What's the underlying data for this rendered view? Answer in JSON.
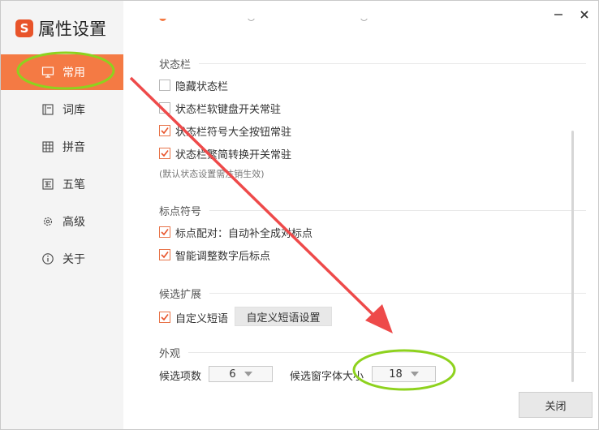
{
  "app": {
    "title": "属性设置",
    "logo_letter": "S"
  },
  "sidebar": {
    "items": [
      {
        "label": "常用",
        "icon": "monitor-icon",
        "active": true
      },
      {
        "label": "词库",
        "icon": "dictionary-icon",
        "active": false
      },
      {
        "label": "拼音",
        "icon": "pinyin-grid-icon",
        "active": false
      },
      {
        "label": "五笔",
        "icon": "wubi-icon",
        "active": false
      },
      {
        "label": "高级",
        "icon": "gear-icon",
        "active": false
      },
      {
        "label": "关于",
        "icon": "info-icon",
        "active": false
      }
    ]
  },
  "window_controls": {
    "minimize": "minimize-icon",
    "close": "close-icon"
  },
  "status_bar": {
    "title": "状态栏",
    "options": [
      {
        "label": "隐藏状态栏",
        "checked": false
      },
      {
        "label": "状态栏软键盘开关常驻",
        "checked": false
      },
      {
        "label": "状态栏符号大全按钮常驻",
        "checked": true
      },
      {
        "label": "状态栏繁简转换开关常驻",
        "checked": true
      }
    ],
    "note": "(默认状态设置需注销生效)"
  },
  "punctuation": {
    "title": "标点符号",
    "options": [
      {
        "label": "标点配对：自动补全成对标点",
        "checked": true
      },
      {
        "label": "智能调整数字后标点",
        "checked": true
      }
    ]
  },
  "candidate_ext": {
    "title": "候选扩展",
    "custom_phrase": {
      "label": "自定义短语",
      "checked": true
    },
    "settings_button": "自定义短语设置"
  },
  "appearance": {
    "title": "外观",
    "candidate_count_label": "候选项数",
    "candidate_count_value": "6",
    "font_size_label": "候选窗字体大小",
    "font_size_value": "18"
  },
  "footer": {
    "close_button": "关闭"
  },
  "colors": {
    "accent": "#f47a44",
    "highlight_ring": "#8ed21e",
    "arrow": "#ee4a4a"
  }
}
